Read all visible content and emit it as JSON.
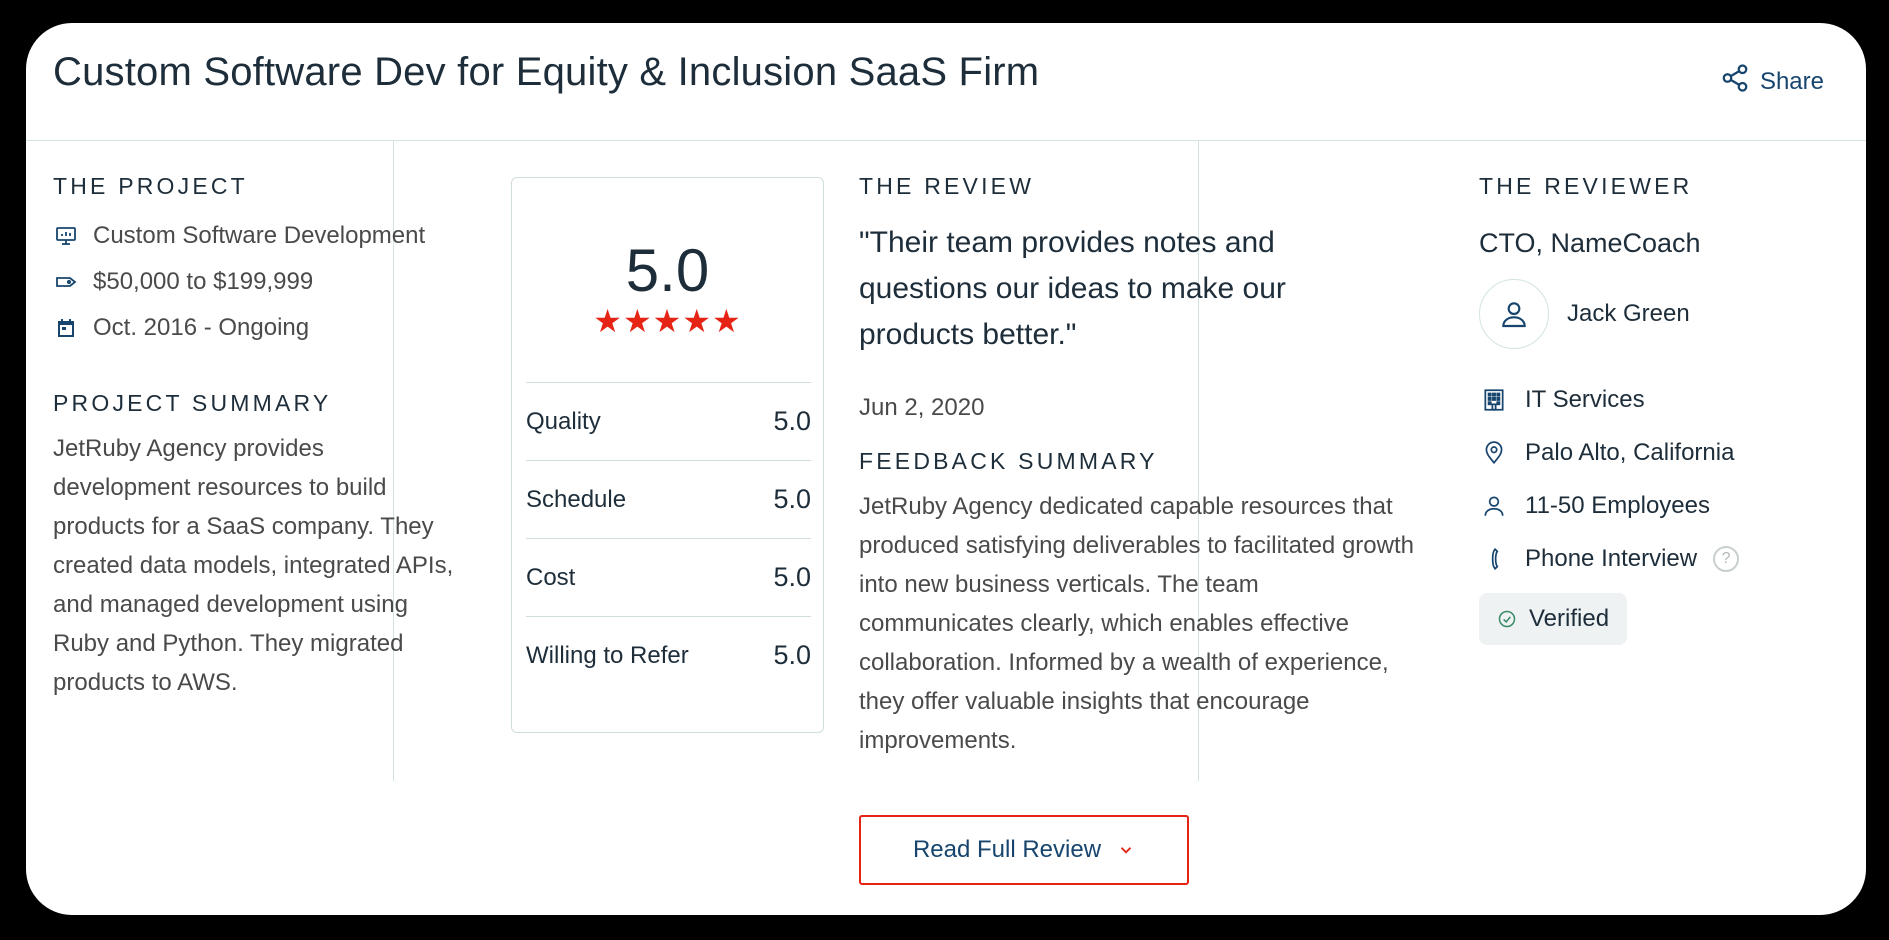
{
  "header": {
    "title": "Custom Software Dev for Equity & Inclusion SaaS Firm",
    "share_label": "Share"
  },
  "project": {
    "heading": "THE PROJECT",
    "items": [
      {
        "icon": "monitor-icon",
        "text": "Custom Software Development"
      },
      {
        "icon": "price-tag-icon",
        "text": "$50,000 to $199,999"
      },
      {
        "icon": "calendar-icon",
        "text": "Oct. 2016 - Ongoing"
      }
    ],
    "summary_heading": "PROJECT SUMMARY",
    "summary": "JetRuby Agency provides development resources to build products for a SaaS company. They created data models, integrated APIs, and managed development using Ruby and Python. They migrated products to AWS."
  },
  "scores": {
    "overall": "5.0",
    "stars": "★★★★★",
    "star_count": 5,
    "rows": [
      {
        "label": "Quality",
        "value": "5.0"
      },
      {
        "label": "Schedule",
        "value": "5.0"
      },
      {
        "label": "Cost",
        "value": "5.0"
      },
      {
        "label": "Willing to Refer",
        "value": "5.0"
      }
    ]
  },
  "review": {
    "heading": "THE REVIEW",
    "quote": "\"Their team provides notes and questions our ideas to make our products better.\"",
    "date": "Jun 2, 2020",
    "feedback_heading": "FEEDBACK SUMMARY",
    "feedback": "JetRuby Agency dedicated capable resources that produced satisfying deliverables to facilitated growth into new business verticals. The team communicates clearly, which enables effective collaboration. Informed by a wealth of experience, they offer valuable insights that encourage improvements."
  },
  "reviewer": {
    "heading": "THE REVIEWER",
    "role": "CTO, NameCoach",
    "name": "Jack Green",
    "industry": "IT Services",
    "location": "Palo Alto, California",
    "size": "11-50 Employees",
    "interview": "Phone Interview",
    "help": "?",
    "verified": "Verified"
  },
  "actions": {
    "read_full_review": "Read Full Review"
  },
  "colors": {
    "accent_red": "#e62415",
    "link_blue": "#17456e",
    "divider": "#d3e3e3"
  }
}
